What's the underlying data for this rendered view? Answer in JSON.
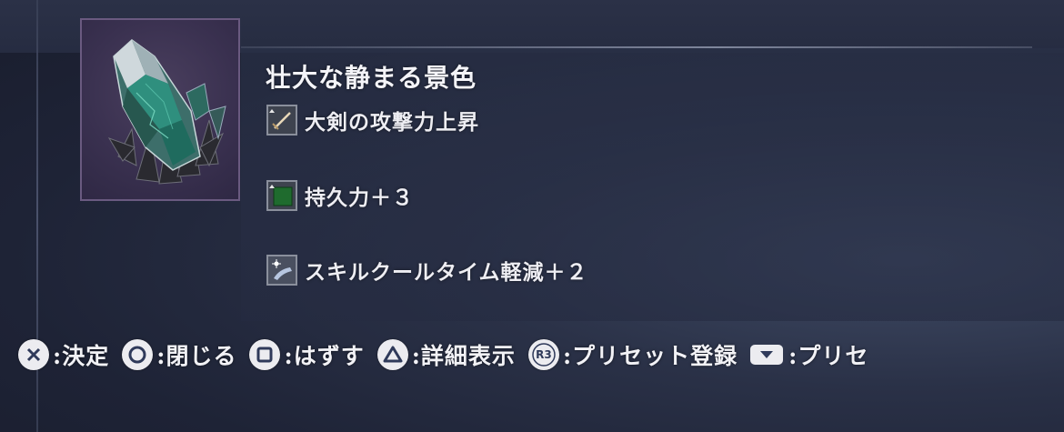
{
  "item": {
    "name": "壮大な静まる景色",
    "image_icon": "dark-crystal-shard-icon",
    "effects": [
      {
        "icon": "greatsword-attack-up-icon",
        "label": "大剣の攻撃力上昇"
      },
      {
        "icon": "stamina-up-icon",
        "label": "持久力＋３"
      },
      {
        "icon": "skill-cooldown-icon",
        "label": "スキルクールタイム軽減＋２"
      }
    ]
  },
  "controls": [
    {
      "button": "cross-button-icon",
      "label": ":決定"
    },
    {
      "button": "circle-button-icon",
      "label": ":閉じる"
    },
    {
      "button": "square-button-icon",
      "label": ":はずす"
    },
    {
      "button": "triangle-button-icon",
      "label": ":詳細表示"
    },
    {
      "button": "r3-button-icon",
      "button_text": "R3",
      "label": ":プリセット登録"
    },
    {
      "button": "touchpad-button-icon",
      "label": ":プリセ"
    }
  ],
  "colors": {
    "background": "#23293d",
    "text": "#f0f0f4",
    "thumb_border": "#6a5a80",
    "button_face": "#ececf0",
    "button_glyph": "#2f3a5a"
  }
}
